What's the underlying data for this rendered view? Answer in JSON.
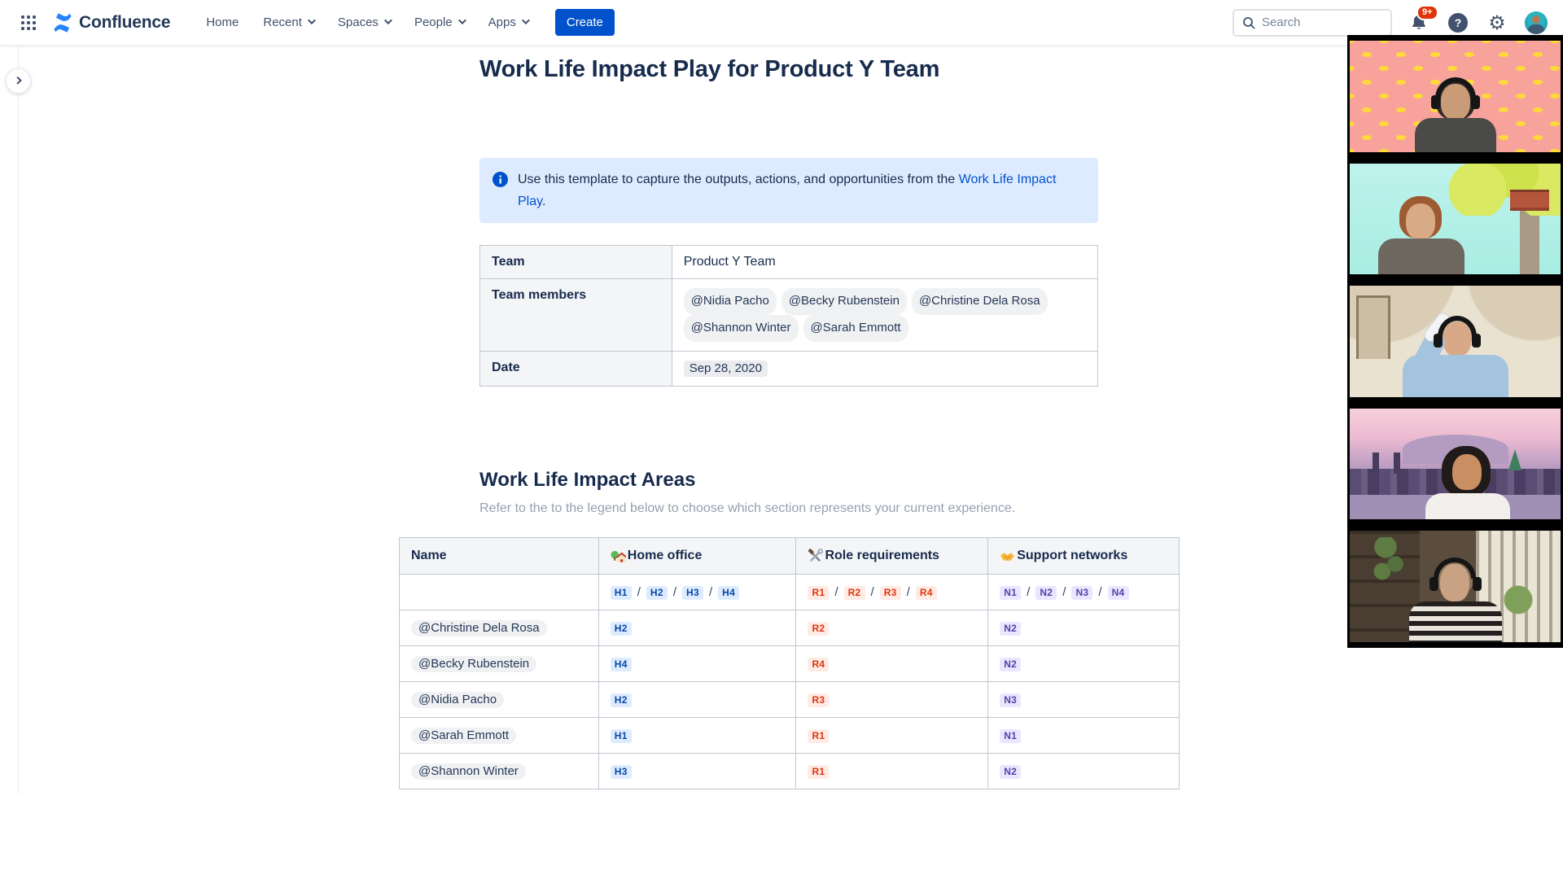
{
  "nav": {
    "brand": "Confluence",
    "items": [
      {
        "label": "Home",
        "dropdown": false
      },
      {
        "label": "Recent",
        "dropdown": true
      },
      {
        "label": "Spaces",
        "dropdown": true
      },
      {
        "label": "People",
        "dropdown": true
      },
      {
        "label": "Apps",
        "dropdown": true
      }
    ],
    "create_label": "Create",
    "search_placeholder": "Search",
    "notifications_badge": "9+",
    "help_glyph": "?",
    "gear_glyph": "⚙"
  },
  "page": {
    "title": "Work Life Impact Play for Product Y Team",
    "info_panel": {
      "text_before": "Use this template to capture the outputs, actions, and opportunities from the ",
      "link_text": "Work Life Impact Play",
      "text_after": "."
    },
    "team_table": {
      "labels": [
        "Team",
        "Team members",
        "Date"
      ],
      "team": "Product Y Team",
      "members": [
        "@Nidia Pacho",
        "@Becky Rubenstein",
        "@Christine Dela Rosa",
        "@Shannon Winter",
        "@Sarah Emmott"
      ],
      "date": "Sep 28, 2020"
    },
    "section": {
      "heading": "Work Life Impact Areas",
      "subtitle": "Refer to the to the legend below to choose which section represents your current experience."
    },
    "impact_table": {
      "headers": [
        {
          "label": "Name",
          "icon": null
        },
        {
          "label": "Home office",
          "icon": "home-emoji-icon"
        },
        {
          "label": "Role requirements",
          "icon": "tools-emoji-icon"
        },
        {
          "label": "Support networks",
          "icon": "handshake-emoji-icon"
        }
      ],
      "legend": {
        "home": [
          "H1",
          "H2",
          "H3",
          "H4"
        ],
        "role": [
          "R1",
          "R2",
          "R3",
          "R4"
        ],
        "network": [
          "N1",
          "N2",
          "N3",
          "N4"
        ]
      },
      "rows": [
        {
          "name": "@Christine Dela Rosa",
          "home": "H2",
          "role": "R2",
          "network": "N2"
        },
        {
          "name": "@Becky Rubenstein",
          "home": "H4",
          "role": "R4",
          "network": "N2"
        },
        {
          "name": "@Nidia Pacho",
          "home": "H2",
          "role": "R3",
          "network": "N3"
        },
        {
          "name": "@Sarah Emmott",
          "home": "H1",
          "role": "R1",
          "network": "N1"
        },
        {
          "name": "@Shannon Winter",
          "home": "H3",
          "role": "R1",
          "network": "N2"
        }
      ]
    }
  },
  "video_strip": {
    "participant_count": 5,
    "participants": [
      {
        "name": "participant-1",
        "scene": "banana-pattern-background"
      },
      {
        "name": "participant-2",
        "scene": "treehouse-illustration-background"
      },
      {
        "name": "participant-3",
        "scene": "cream-room-drinking-bottle"
      },
      {
        "name": "participant-4",
        "scene": "city-skyline-dusk-background"
      },
      {
        "name": "participant-5",
        "scene": "home-office-window-blinds"
      }
    ]
  },
  "colors": {
    "accent": "#0052CC",
    "nav_icon": "#42526E",
    "info_panel_bg": "#DEEBFF",
    "lozenge_blue_bg": "#DEEBFF",
    "lozenge_blue_text": "#0747A6",
    "lozenge_red_bg": "#FFEBE6",
    "lozenge_red_text": "#DE350B",
    "lozenge_purple_bg": "#EAE6FF",
    "lozenge_purple_text": "#5243AA",
    "notification_badge": "#DE350B",
    "table_border": "#C1C7D0",
    "header_cell_bg": "#F4F5F7"
  }
}
